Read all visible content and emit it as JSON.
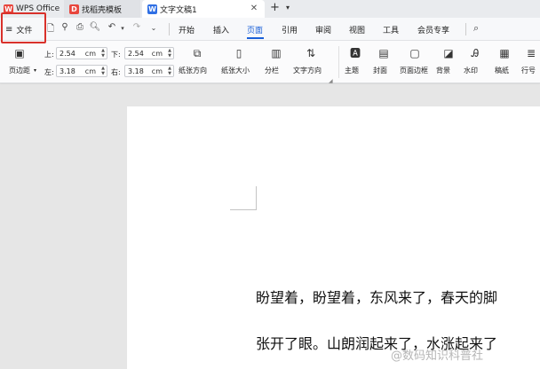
{
  "tabs": {
    "wps": "WPS Office",
    "template": "找稻壳模板",
    "doc": "文字文稿1"
  },
  "menu": {
    "file": "文件",
    "items": [
      "开始",
      "插入",
      "页面",
      "引用",
      "审阅",
      "视图",
      "工具",
      "会员专享"
    ],
    "active": "页面"
  },
  "ribbon": {
    "margins_label": "页边距",
    "top_label": "上:",
    "top_value": "2.54",
    "bottom_label": "下:",
    "bottom_value": "2.54",
    "left_label": "左:",
    "left_value": "3.18",
    "right_label": "右:",
    "right_value": "3.18",
    "unit": "cm",
    "orientation": "纸张方向",
    "size": "纸张大小",
    "columns": "分栏",
    "text_direction": "文字方向",
    "theme": "主题",
    "cover": "封面",
    "page_border": "页面边框",
    "background": "背景",
    "watermark": "水印",
    "paper": "稿纸",
    "line_number": "行号"
  },
  "document": {
    "line1": "盼望着，盼望着，东风来了，春天的脚",
    "line2": "张开了眼。山朗润起来了，水涨起来了"
  },
  "watermark_text": "@数码知识科普社",
  "colors": {
    "accent": "#1a5fd8",
    "highlight": "#d9312b"
  }
}
